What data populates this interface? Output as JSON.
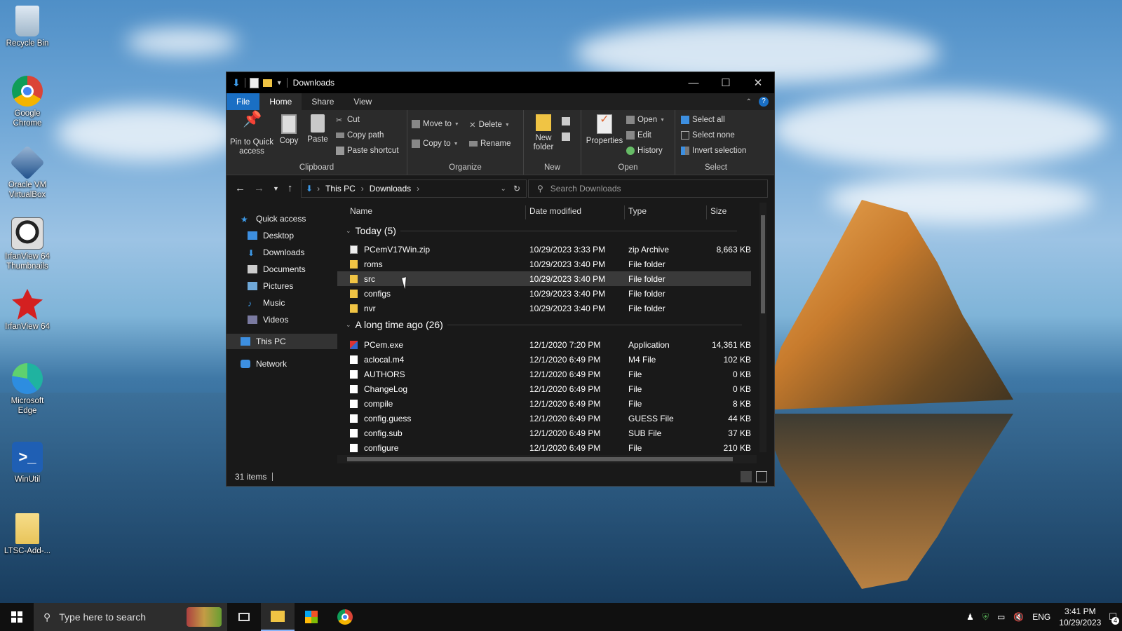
{
  "desktop": {
    "icons": [
      {
        "label": "Recycle Bin",
        "icon": "recycle-bin-icon"
      },
      {
        "label": "Google Chrome",
        "icon": "chrome-icon"
      },
      {
        "label": "Oracle VM VirtualBox",
        "icon": "virtualbox-icon"
      },
      {
        "label": "IrfanView 64 Thumbnails",
        "icon": "irfanview-thumbnails-icon"
      },
      {
        "label": "IrfanView 64",
        "icon": "irfanview-icon"
      },
      {
        "label": "Microsoft Edge",
        "icon": "edge-icon"
      },
      {
        "label": "WinUtil",
        "icon": "powershell-icon"
      },
      {
        "label": "LTSC-Add-...",
        "icon": "folder-icon"
      }
    ]
  },
  "window": {
    "title": "Downloads",
    "tabs": {
      "file": "File",
      "home": "Home",
      "share": "Share",
      "view": "View"
    },
    "ribbon": {
      "clipboard": {
        "name": "Clipboard",
        "pin": "Pin to Quick access",
        "copy": "Copy",
        "paste": "Paste",
        "cut": "Cut",
        "copy_path": "Copy path",
        "paste_shortcut": "Paste shortcut"
      },
      "organize": {
        "name": "Organize",
        "move_to": "Move to",
        "copy_to": "Copy to",
        "delete": "Delete",
        "rename": "Rename"
      },
      "new": {
        "name": "New",
        "new_folder": "New folder"
      },
      "open": {
        "name": "Open",
        "properties": "Properties",
        "open": "Open",
        "edit": "Edit",
        "history": "History"
      },
      "select": {
        "name": "Select",
        "select_all": "Select all",
        "select_none": "Select none",
        "invert": "Invert selection"
      }
    },
    "address": {
      "this_pc": "This PC",
      "downloads": "Downloads"
    },
    "search": {
      "placeholder": "Search Downloads"
    },
    "nav": {
      "quick_access": "Quick access",
      "desktop": "Desktop",
      "downloads": "Downloads",
      "documents": "Documents",
      "pictures": "Pictures",
      "music": "Music",
      "videos": "Videos",
      "this_pc": "This PC",
      "network": "Network"
    },
    "columns": {
      "name": "Name",
      "date": "Date modified",
      "type": "Type",
      "size": "Size"
    },
    "groups": {
      "today": "Today (5)",
      "long_ago": "A long time ago (26)"
    },
    "files_today": [
      {
        "name": "PCemV17Win.zip",
        "date": "10/29/2023 3:33 PM",
        "type": "zip Archive",
        "size": "8,663 KB",
        "icon": "zip-icon"
      },
      {
        "name": "roms",
        "date": "10/29/2023 3:40 PM",
        "type": "File folder",
        "size": "",
        "icon": "folder-icon"
      },
      {
        "name": "src",
        "date": "10/29/2023 3:40 PM",
        "type": "File folder",
        "size": "",
        "icon": "folder-icon"
      },
      {
        "name": "configs",
        "date": "10/29/2023 3:40 PM",
        "type": "File folder",
        "size": "",
        "icon": "folder-icon"
      },
      {
        "name": "nvr",
        "date": "10/29/2023 3:40 PM",
        "type": "File folder",
        "size": "",
        "icon": "folder-icon"
      }
    ],
    "files_old": [
      {
        "name": "PCem.exe",
        "date": "12/1/2020 7:20 PM",
        "type": "Application",
        "size": "14,361 KB",
        "icon": "exe-icon"
      },
      {
        "name": "aclocal.m4",
        "date": "12/1/2020 6:49 PM",
        "type": "M4 File",
        "size": "102 KB",
        "icon": "file-icon"
      },
      {
        "name": "AUTHORS",
        "date": "12/1/2020 6:49 PM",
        "type": "File",
        "size": "0 KB",
        "icon": "file-icon"
      },
      {
        "name": "ChangeLog",
        "date": "12/1/2020 6:49 PM",
        "type": "File",
        "size": "0 KB",
        "icon": "file-icon"
      },
      {
        "name": "compile",
        "date": "12/1/2020 6:49 PM",
        "type": "File",
        "size": "8 KB",
        "icon": "file-icon"
      },
      {
        "name": "config.guess",
        "date": "12/1/2020 6:49 PM",
        "type": "GUESS File",
        "size": "44 KB",
        "icon": "file-icon"
      },
      {
        "name": "config.sub",
        "date": "12/1/2020 6:49 PM",
        "type": "SUB File",
        "size": "37 KB",
        "icon": "file-icon"
      },
      {
        "name": "configure",
        "date": "12/1/2020 6:49 PM",
        "type": "File",
        "size": "210 KB",
        "icon": "file-icon"
      }
    ],
    "status": {
      "items": "31 items"
    }
  },
  "taskbar": {
    "search_placeholder": "Type here to search",
    "lang": "ENG",
    "time": "3:41 PM",
    "date": "10/29/2023",
    "notifications": "4"
  }
}
